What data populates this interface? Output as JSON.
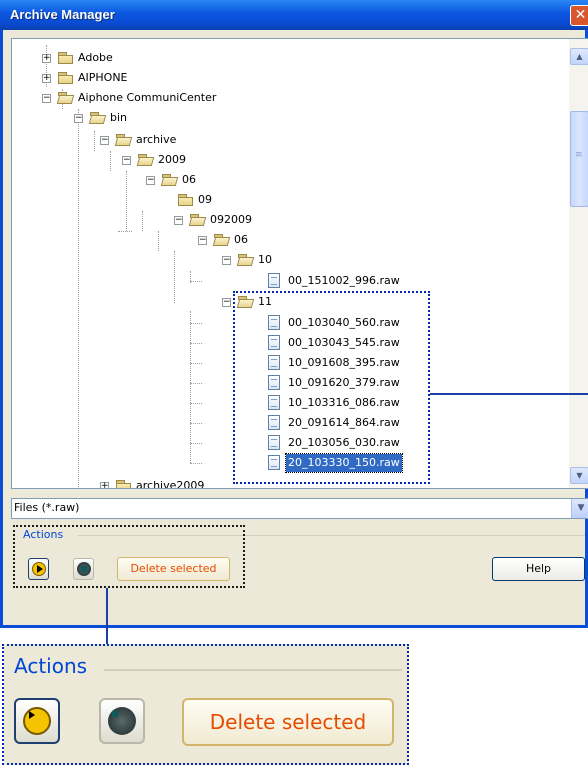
{
  "window": {
    "title": "Archive Manager",
    "close_glyph": "✕"
  },
  "tree": {
    "expand_glyph": "+",
    "collapse_glyph": "−",
    "nodes": [
      {
        "label": "Adobe"
      },
      {
        "label": "AIPHONE"
      },
      {
        "label": "Aiphone CommuniCenter"
      },
      {
        "label": "bin"
      },
      {
        "label": "archive"
      },
      {
        "label": "2009"
      },
      {
        "label": "06"
      },
      {
        "label": "09"
      },
      {
        "label": "092009"
      },
      {
        "label": "06"
      },
      {
        "label": "10"
      },
      {
        "label": "00_151002_996.raw"
      },
      {
        "label": "11"
      },
      {
        "label": "00_103040_560.raw"
      },
      {
        "label": "00_103043_545.raw"
      },
      {
        "label": "10_091608_395.raw"
      },
      {
        "label": "10_091620_379.raw"
      },
      {
        "label": "10_103316_086.raw"
      },
      {
        "label": "20_091614_864.raw"
      },
      {
        "label": "20_103056_030.raw"
      },
      {
        "label": "20_103330_150.raw",
        "selected": true
      },
      {
        "label": "archive2009"
      }
    ]
  },
  "scrollbar": {
    "up_glyph": "▲",
    "down_glyph": "▼",
    "grip_glyph": "≡"
  },
  "filter": {
    "value": "Files (*.raw)",
    "arrow_glyph": "▼"
  },
  "actions": {
    "group_label": "Actions",
    "play_icon": "play-icon",
    "stop_icon": "stop-icon",
    "delete_label": "Delete selected"
  },
  "help_label": "Help",
  "zoom": {
    "group_label": "Actions",
    "delete_label": "Delete selected"
  },
  "colors": {
    "titlebar": "#0b56e1",
    "selection": "#316ac5",
    "callout": "#0028b4",
    "delete_text": "#e84a00"
  }
}
